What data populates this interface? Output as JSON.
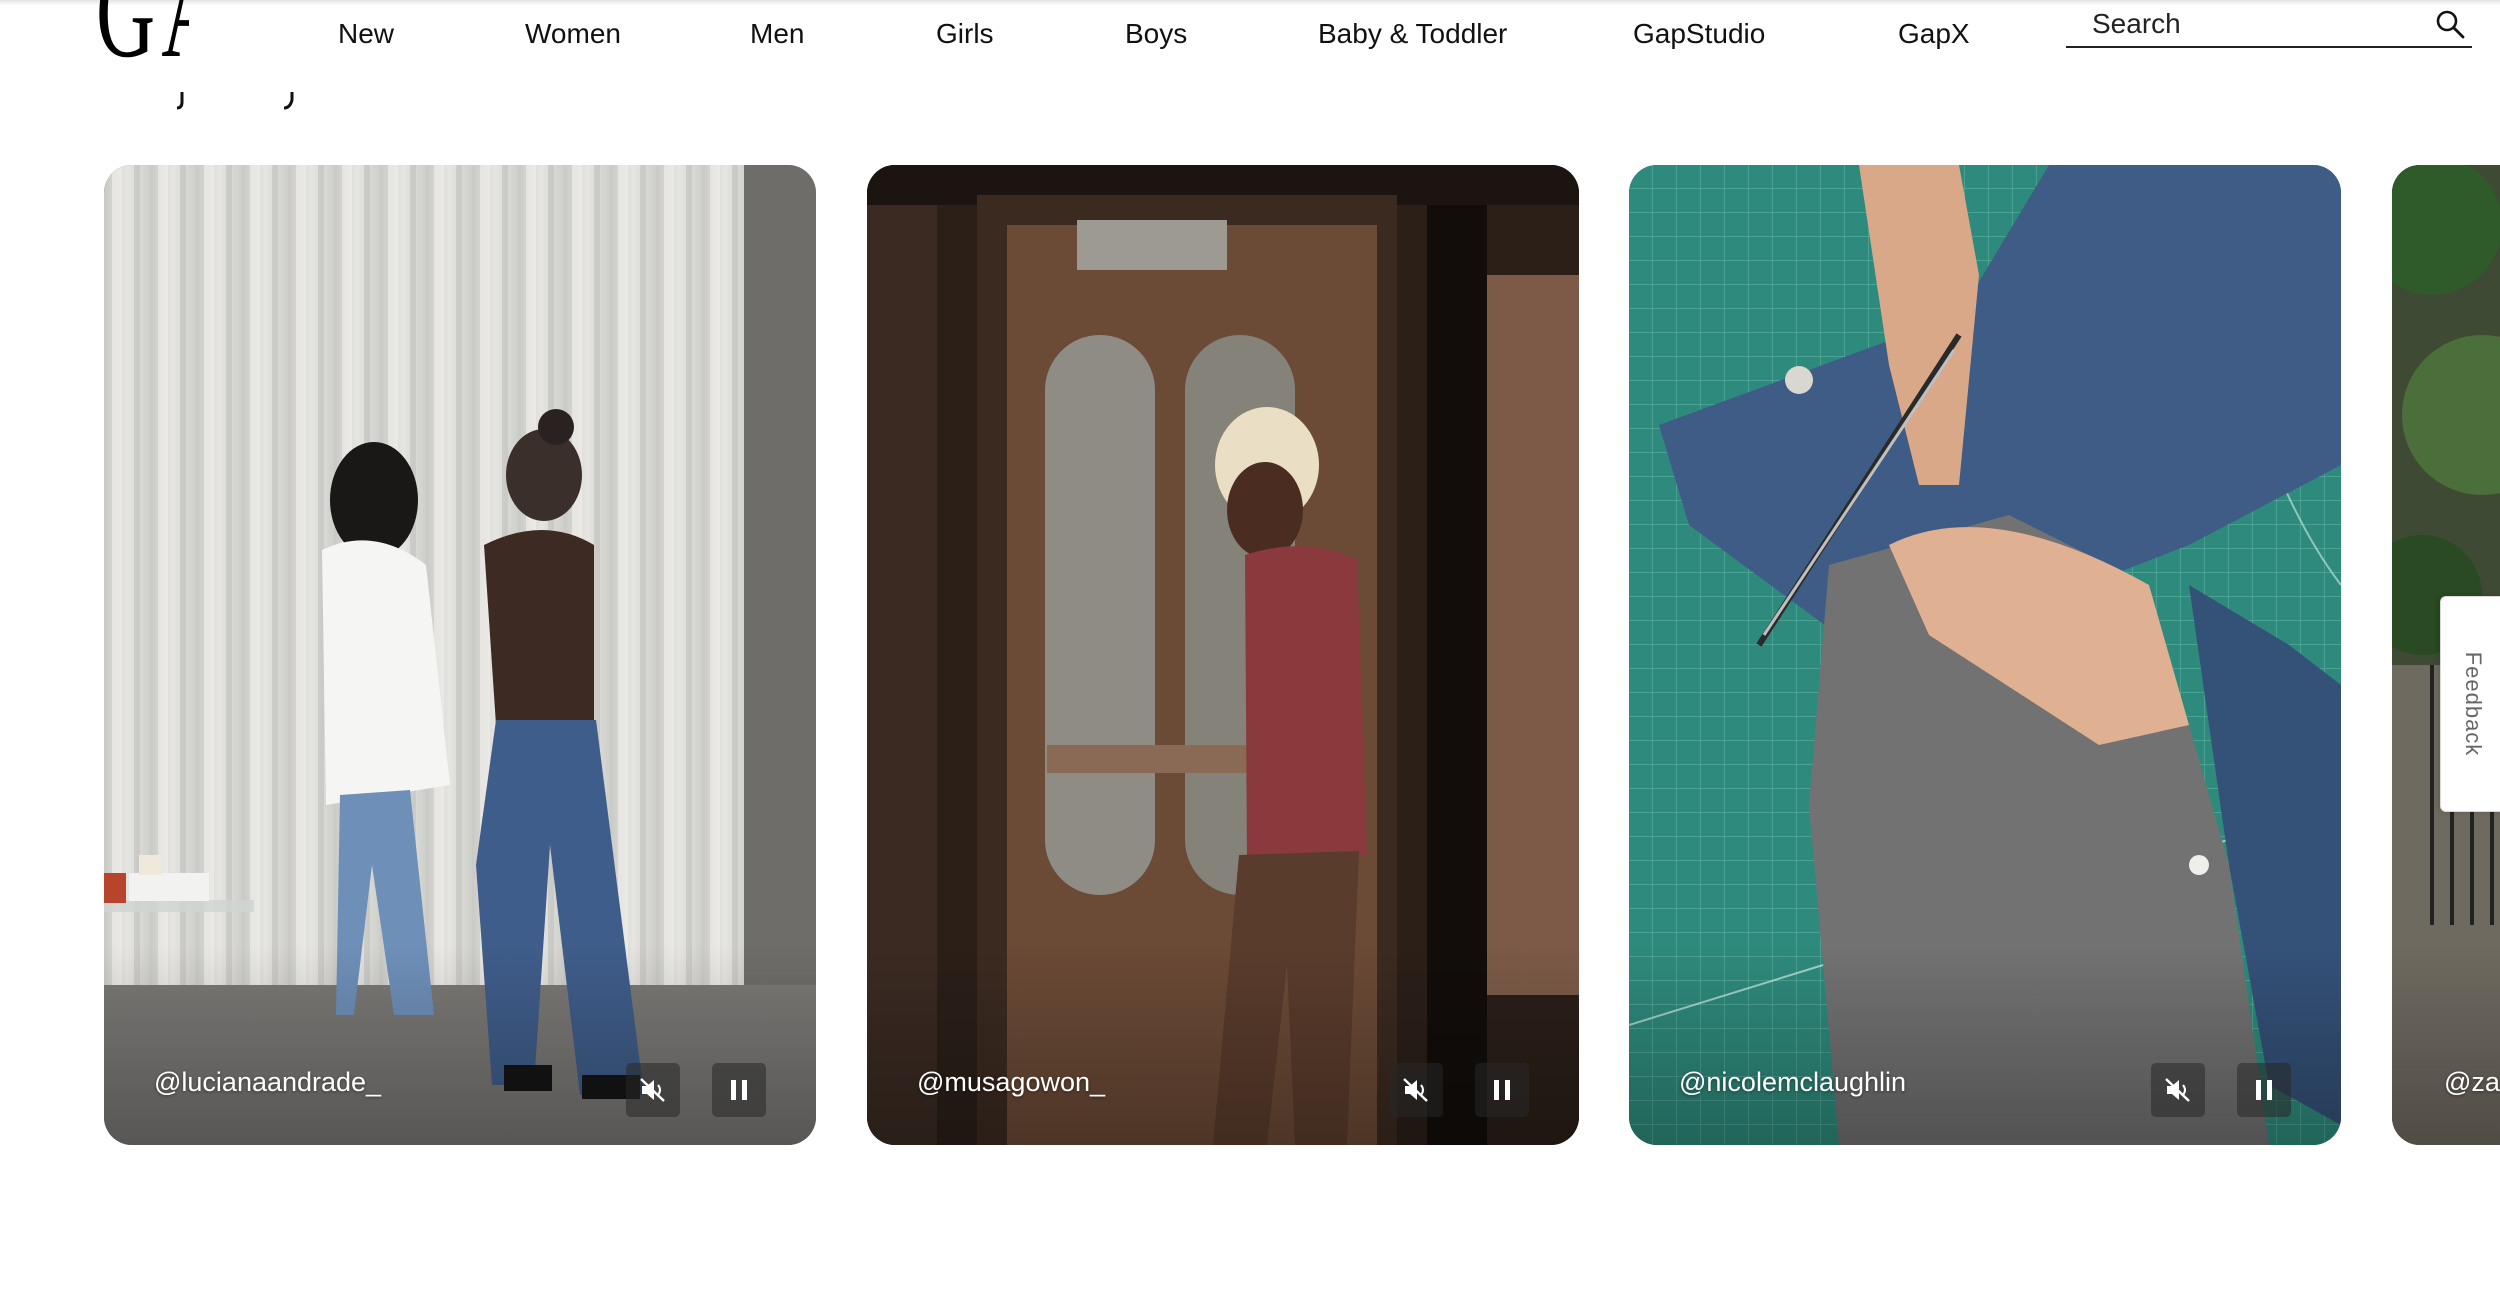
{
  "header": {
    "logo": "GAP",
    "nav": [
      "New",
      "Women",
      "Men",
      "Girls",
      "Boys",
      "Baby & Toddler",
      "GapStudio",
      "GapX"
    ],
    "search_placeholder": "Search",
    "icon": "search-icon"
  },
  "carousel": {
    "cards": [
      {
        "handle": "@lucianaandrade_",
        "icons": [
          "mute-icon",
          "pause-icon"
        ]
      },
      {
        "handle": "@musagowon_",
        "icons": [
          "mute-icon",
          "pause-icon"
        ]
      },
      {
        "handle": "@nicolemclaughlin",
        "icons": [
          "mute-icon",
          "pause-icon"
        ]
      },
      {
        "handle": "@zal"
      }
    ]
  },
  "feedback_label": "Feedback",
  "colors": {
    "text": "#111111",
    "background": "#ffffff",
    "cutting_mat": "#2e8a7c",
    "denim": "#3e5c86"
  }
}
